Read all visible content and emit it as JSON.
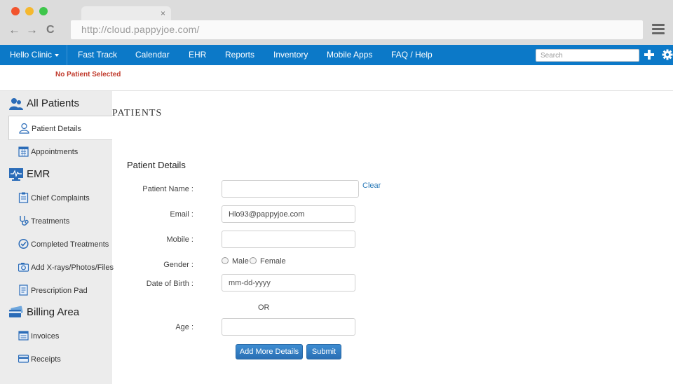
{
  "browser": {
    "url": "http://cloud.pappyjoe.com/",
    "tab_close": "×",
    "back": "←",
    "forward": "→",
    "reload": "C"
  },
  "topnav": {
    "clinic": "Hello Clinic",
    "items": [
      "Fast Track",
      "Calendar",
      "EHR",
      "Reports",
      "Inventory",
      "Mobile Apps",
      "FAQ / Help"
    ],
    "search_placeholder": "Search"
  },
  "status": {
    "no_patient": "No Patient Selected"
  },
  "sidebar": {
    "all_patients": "All Patients",
    "patient_details": "Patient Details",
    "appointments": "Appointments",
    "emr": "EMR",
    "chief_complaints": "Chief Complaints",
    "treatments": "Treatments",
    "completed_treatments": "Completed Treatments",
    "add_files": "Add X-rays/Photos/Files",
    "prescription_pad": "Prescription Pad",
    "billing_area": "Billing Area",
    "invoices": "Invoices",
    "receipts": "Receipts"
  },
  "main": {
    "heading": "PATIENTS",
    "form_title": "Patient Details",
    "labels": {
      "name": "Patient Name :",
      "email": "Email :",
      "mobile": "Mobile :",
      "gender": "Gender :",
      "dob": "Date of Birth :",
      "age": "Age :"
    },
    "values": {
      "name": "",
      "email": "Hlo93@pappyjoe.com",
      "mobile": "",
      "age": ""
    },
    "dob_placeholder": "mm-dd-yyyy",
    "clear": "Clear",
    "gender_options": [
      "Male",
      "Female"
    ],
    "or": "OR",
    "add_more_button": "Add More Details",
    "submit_button": "Submit"
  },
  "colors": {
    "nav_blue": "#0c79c8",
    "warning_red": "#c0392b",
    "link_blue": "#2a7ab8"
  }
}
